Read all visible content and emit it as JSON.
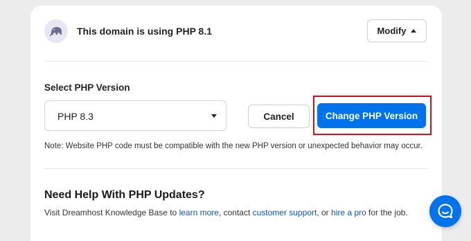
{
  "domain": {
    "status_text": "This domain is using PHP 8.1",
    "modify_label": "Modify"
  },
  "php_version": {
    "section_label": "Select PHP Version",
    "selected_value": "PHP 8.3",
    "cancel_label": "Cancel",
    "change_label": "Change PHP Version",
    "note": "Note: Website PHP code must be compatible with the new PHP version or unexpected behavior may occur."
  },
  "help": {
    "title": "Need Help With PHP Updates?",
    "text_1": "Visit Dreamhost Knowledge Base to ",
    "link_learn_more": "learn more",
    "text_2": ", contact ",
    "link_support": "customer support",
    "text_3": ", or ",
    "link_hire": "hire a pro",
    "text_4": " for the job."
  },
  "icons": {
    "php": "elephant-icon",
    "chat": "chat-bubble-icon",
    "modify_caret": "caret-up-icon",
    "select_caret": "caret-down-icon"
  },
  "colors": {
    "primary": "#0073ec",
    "highlight": "#d2101b",
    "link": "#0b52c9"
  }
}
